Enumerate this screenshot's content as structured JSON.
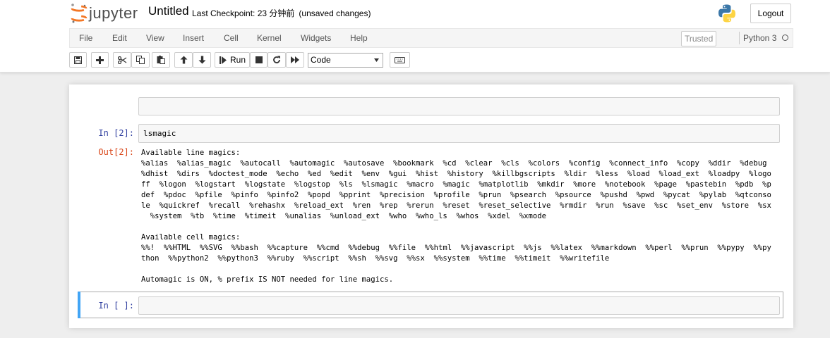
{
  "header": {
    "app_name": "jupyter",
    "notebook_name": "Untitled",
    "checkpoint": "Last Checkpoint: 23 分钟前",
    "unsaved": "(unsaved changes)",
    "logout_label": "Logout"
  },
  "menu": {
    "items": [
      "File",
      "Edit",
      "View",
      "Insert",
      "Cell",
      "Kernel",
      "Widgets",
      "Help"
    ],
    "trusted": "Trusted",
    "kernel": "Python 3"
  },
  "toolbar": {
    "run_label": "Run",
    "cell_type": "Code",
    "icons": [
      "save-icon",
      "plus-icon",
      "cut-icon",
      "copy-icon",
      "paste-icon",
      "arrow-up-icon",
      "arrow-down-icon",
      "step-forward-icon",
      "stop-icon",
      "refresh-icon",
      "fast-forward-icon",
      "keyboard-icon"
    ]
  },
  "cells": {
    "cell2_prompt": "In [2]:",
    "cell2_code": "lsmagic",
    "out2_prompt": "Out[2]:",
    "out2_text": "Available line magics:\n%alias  %alias_magic  %autocall  %automagic  %autosave  %bookmark  %cd  %clear  %cls  %colors  %config  %connect_info  %copy  %ddir  %debug\n%dhist  %dirs  %doctest_mode  %echo  %ed  %edit  %env  %gui  %hist  %history  %killbgscripts  %ldir  %less  %load  %load_ext  %loadpy  %logo\nff  %logon  %logstart  %logstate  %logstop  %ls  %lsmagic  %macro  %magic  %matplotlib  %mkdir  %more  %notebook  %page  %pastebin  %pdb  %p\ndef  %pdoc  %pfile  %pinfo  %pinfo2  %popd  %pprint  %precision  %profile  %prun  %psearch  %psource  %pushd  %pwd  %pycat  %pylab  %qtconso\nle  %quickref  %recall  %rehashx  %reload_ext  %ren  %rep  %rerun  %reset  %reset_selective  %rmdir  %run  %save  %sc  %set_env  %store  %sx\n  %system  %tb  %time  %timeit  %unalias  %unload_ext  %who  %who_ls  %whos  %xdel  %xmode\n\nAvailable cell magics:\n%%!  %%HTML  %%SVG  %%bash  %%capture  %%cmd  %%debug  %%file  %%html  %%javascript  %%js  %%latex  %%markdown  %%perl  %%prun  %%pypy  %%py\nthon  %%python2  %%python3  %%ruby  %%script  %%sh  %%svg  %%sx  %%system  %%time  %%timeit  %%writefile\n\nAutomagic is ON, % prefix IS NOT needed for line magics.",
    "empty_prompt": "In [ ]:"
  },
  "colors": {
    "selected_cell_accent": "#42a5f5",
    "prompt_in": "#303f9f",
    "prompt_out": "#d84315",
    "jupyter_orange": "#f37726"
  }
}
